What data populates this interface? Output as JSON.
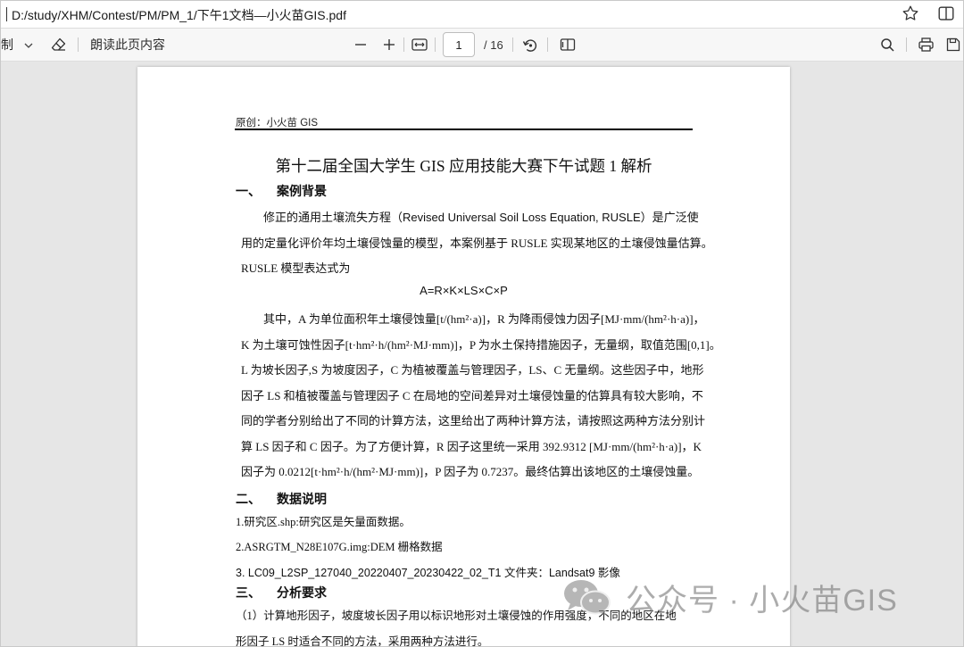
{
  "address_bar": {
    "path": "D:/study/XHM/Contest/PM/PM_1/下午1文档—小火苗GIS.pdf",
    "star_icon": "favorite-star-icon",
    "split_icon": "split-screen-icon"
  },
  "toolbar": {
    "draw_label": "制",
    "read_aloud_label": "朗读此页内容",
    "current_page": "1",
    "total_pages": "/ 16"
  },
  "document": {
    "header_text": "原创：小火苗 GIS",
    "title": "第十二届全国大学生 GIS 应用技能大赛下午试题 1 解析",
    "section1": {
      "num": "一、",
      "title": "案例背景"
    },
    "s1_lines": [
      "修正的通用土壤流失方程（Revised Universal Soil Loss Equation, RUSLE）是广泛使",
      "用的定量化评价年均土壤侵蚀量的模型，本案例基于 RUSLE 实现某地区的土壤侵蚀量估算。",
      "RUSLE 模型表达式为"
    ],
    "formula": "A=R×K×LS×C×P",
    "s1_para2": [
      "其中，A 为单位面积年土壤侵蚀量[t/(hm²·a)]，R 为降雨侵蚀力因子[MJ·mm/(hm²·h·a)]，",
      "K 为土壤可蚀性因子[t·hm²·h/(hm²·MJ·mm)]，P 为水土保持措施因子，无量纲，取值范围[0,1]。",
      "L 为坡长因子,S 为坡度因子，C 为植被覆盖与管理因子，LS、C 无量纲。这些因子中，地形",
      "因子 LS 和植被覆盖与管理因子 C 在局地的空间差异对土壤侵蚀量的估算具有较大影响，不",
      "同的学者分别给出了不同的计算方法，这里给出了两种计算方法，请按照这两种方法分别计",
      "算 LS 因子和 C 因子。为了方便计算，R 因子这里统一采用 392.9312 [MJ·mm/(hm²·h·a)]，K",
      "因子为 0.0212[t·hm²·h/(hm²·MJ·mm)]，P 因子为 0.7237。最终估算出该地区的土壤侵蚀量。"
    ],
    "section2": {
      "num": "二、",
      "title": "数据说明"
    },
    "s2_items": [
      "1.研究区.shp:研究区是矢量面数据。",
      "2.ASRGTM_N28E107G.img:DEM 栅格数据",
      "3. LC09_L2SP_127040_20220407_20230422_02_T1  文件夹：Landsat9  影像"
    ],
    "section3": {
      "num": "三、",
      "title": "分析要求"
    },
    "s3_lines": [
      "（1）计算地形因子，坡度坡长因子用以标识地形对土壤侵蚀的作用强度，不同的地区在地",
      "形因子 LS 时适合不同的方法，采用两种方法进行。"
    ]
  },
  "watermark": {
    "text": "公众号 · 小火苗GIS",
    "icon": "wechat-icon"
  }
}
